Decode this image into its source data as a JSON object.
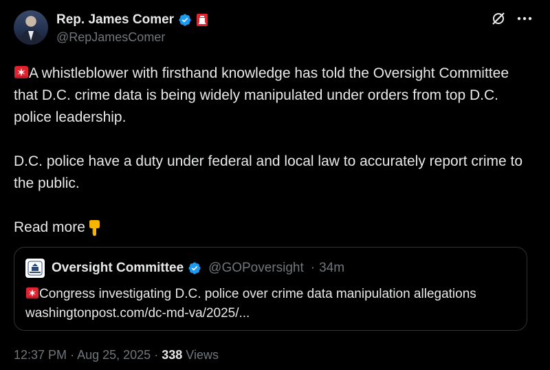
{
  "author": {
    "name": "Rep. James Comer",
    "handle": "@RepJamesComer"
  },
  "post": {
    "para1": "A whistleblower with firsthand knowledge has told the Oversight Committee that D.C. crime data is being widely manipulated under orders from top D.C. police leadership.",
    "para2": "D.C. police have a duty under federal and local law to accurately report crime to the public.",
    "read_more": "Read more"
  },
  "quoted": {
    "name": "Oversight Committee",
    "handle": "@GOPoversight",
    "separator": "·",
    "time": "34m",
    "headline": "Congress investigating D.C. police over crime data manipulation allegations",
    "link": "washingtonpost.com/dc-md-va/2025/..."
  },
  "meta": {
    "time": "12:37 PM",
    "separator": "·",
    "date": "Aug 25, 2025",
    "views_count": "338",
    "views_label": "Views"
  },
  "icons": {
    "verified": "verified-badge-icon",
    "siren": "police-siren-emoji",
    "point_down": "backhand-index-pointing-down-emoji",
    "grok": "grok-icon",
    "more": "more-icon"
  },
  "colors": {
    "verified": "#1d9bf0",
    "secondary_text": "#71767b",
    "siren": "#e0242f"
  }
}
